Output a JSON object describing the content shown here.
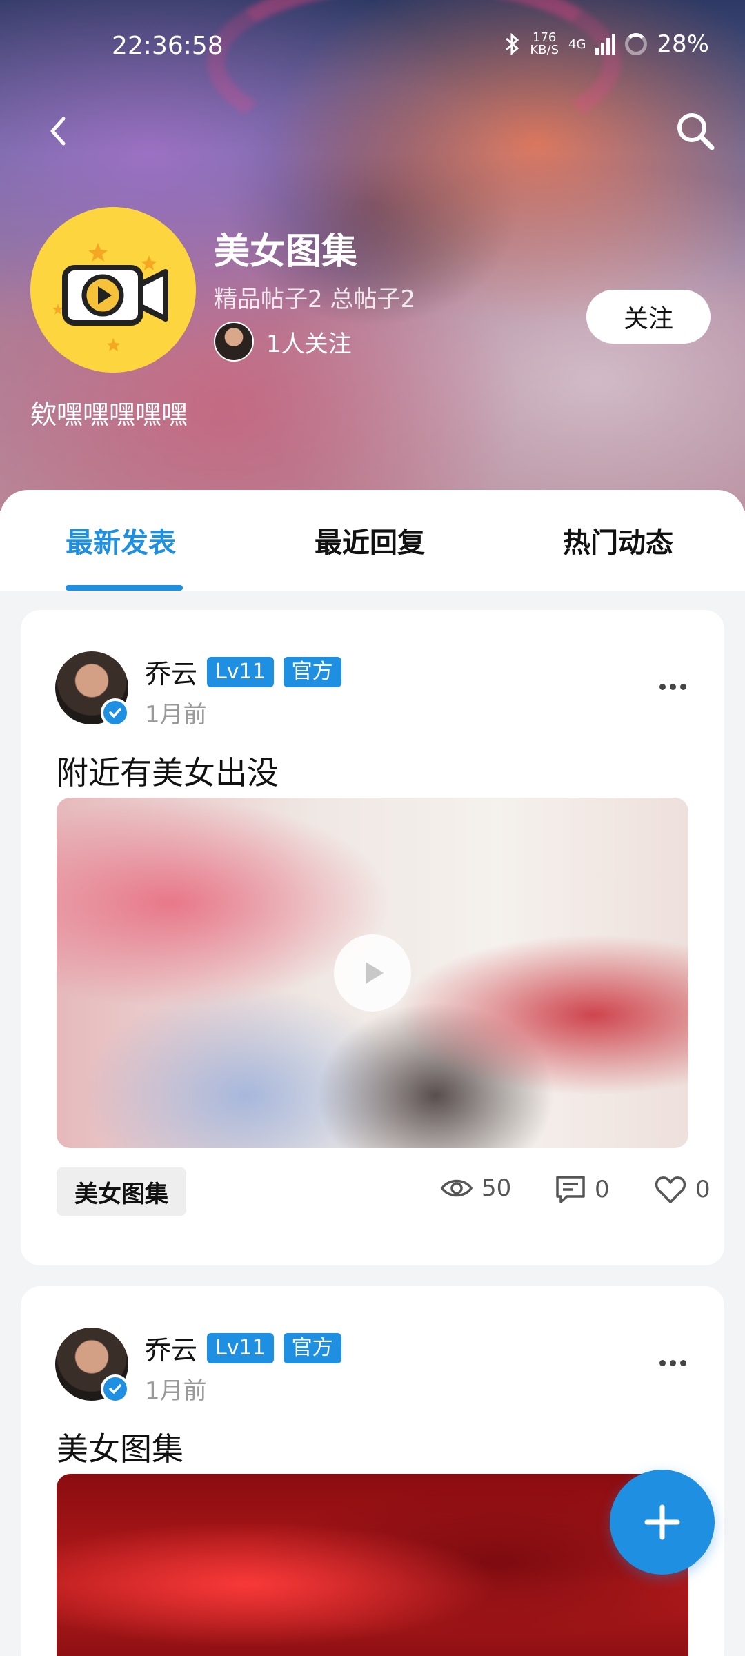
{
  "status_bar": {
    "time": "22:36:58",
    "net_speed_value": "176",
    "net_speed_unit": "KB/S",
    "network": "4G",
    "battery": "28%"
  },
  "header": {
    "title": "美女图集",
    "stats": "精品帖子2 总帖子2",
    "followers": "1人关注",
    "owner": "欸嘿嘿嘿嘿嘿",
    "follow_label": "关注",
    "logo_icon": "video-camera-icon"
  },
  "tabs": [
    {
      "label": "最新发表",
      "active": true
    },
    {
      "label": "最近回复",
      "active": false
    },
    {
      "label": "热门动态",
      "active": false
    }
  ],
  "posts": [
    {
      "author": "乔云",
      "level": "Lv11",
      "role": "官方",
      "time": "1月前",
      "title": "附近有美女出没",
      "tag": "美女图集",
      "views": "50",
      "comments": "0",
      "likes": "0"
    },
    {
      "author": "乔云",
      "level": "Lv11",
      "role": "官方",
      "time": "1月前",
      "title": "美女图集"
    }
  ],
  "colors": {
    "accent": "#1e8fe1",
    "logo_bg": "#fcd53f"
  }
}
